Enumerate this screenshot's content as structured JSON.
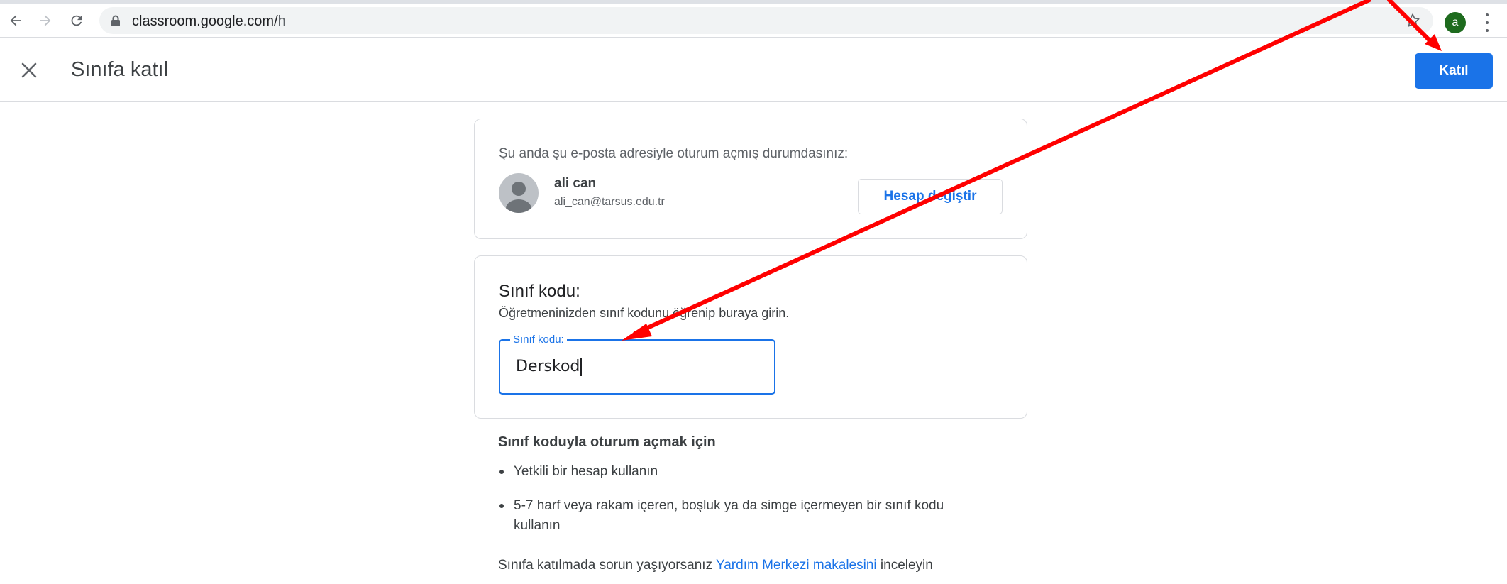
{
  "browser": {
    "url_host": "classroom.google.com/",
    "url_path": "h",
    "profile_initial": "a",
    "icons": {
      "back": "back-arrow-icon",
      "forward": "forward-arrow-icon",
      "reload": "reload-icon",
      "lock": "lock-icon",
      "bookmark": "star-icon",
      "menu": "kebab-menu-icon"
    }
  },
  "header": {
    "title": "Sınıfa katıl",
    "join_label": "Katıl",
    "close_icon": "close-icon"
  },
  "account": {
    "signed_in_text": "Şu anda şu e-posta adresiyle oturum açmış durumdasınız:",
    "name": "ali can",
    "email": "ali_can@tarsus.edu.tr",
    "switch_label": "Hesap değiştir"
  },
  "class_code": {
    "title": "Sınıf kodu:",
    "description": "Öğretmeninizden sınıf kodunu öğrenip buraya girin.",
    "field_label": "Sınıf kodu:",
    "field_value": "Derskod"
  },
  "instructions": {
    "title": "Sınıf koduyla oturum açmak için",
    "items": [
      "Yetkili bir hesap kullanın",
      "5-7 harf veya rakam içeren, boşluk ya da simge içermeyen bir sınıf kodu kullanın"
    ],
    "help_prefix": "Sınıfa katılmada sorun yaşıyorsanız ",
    "help_link": "Yardım Merkezi makalesini",
    "help_suffix": " inceleyin"
  },
  "colors": {
    "accent": "#1a73e8",
    "annotation": "#ff0000"
  }
}
